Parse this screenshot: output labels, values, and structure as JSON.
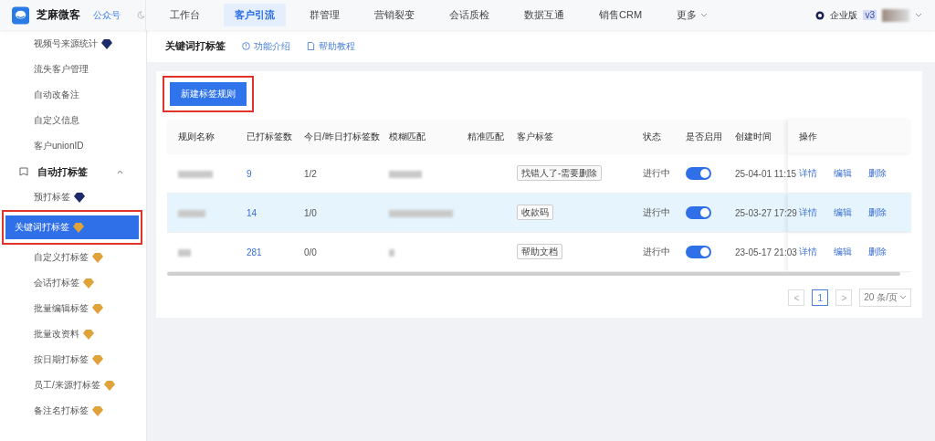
{
  "topbar": {
    "brand": "芝麻微客",
    "account_link": "公众号",
    "nav": [
      {
        "label": "工作台",
        "selected": false
      },
      {
        "label": "客户引流",
        "selected": true
      },
      {
        "label": "群管理",
        "selected": false
      },
      {
        "label": "营销裂变",
        "selected": false
      },
      {
        "label": "会话质检",
        "selected": false
      },
      {
        "label": "数据互通",
        "selected": false
      },
      {
        "label": "销售CRM",
        "selected": false
      },
      {
        "label": "更多",
        "selected": false,
        "kind": "dropdown"
      }
    ],
    "edition": "企业版",
    "version": "v3"
  },
  "sidebar": {
    "items": [
      {
        "label": "视频号来源统计",
        "kind": "item",
        "badge": true,
        "color": "#1d2b6b",
        "selected": false,
        "highlighted": false
      },
      {
        "label": "流失客户管理",
        "kind": "item",
        "badge": false,
        "selected": false,
        "highlighted": false
      },
      {
        "label": "自动改备注",
        "kind": "item",
        "badge": false,
        "selected": false,
        "highlighted": false
      },
      {
        "label": "自定义信息",
        "kind": "item",
        "badge": false,
        "selected": false,
        "highlighted": false
      },
      {
        "label": "客户unionID",
        "kind": "item",
        "badge": false,
        "selected": false,
        "highlighted": false
      },
      {
        "label": "自动打标签",
        "kind": "section",
        "expanded": true
      },
      {
        "label": "预打标签",
        "kind": "item",
        "badge": true,
        "color": "#1d2b6b",
        "selected": false,
        "highlighted": false
      },
      {
        "label": "关键词打标签",
        "kind": "item",
        "badge": true,
        "color": "#e0a33a",
        "selected": true,
        "highlighted": true
      },
      {
        "label": "自定义打标签",
        "kind": "item",
        "badge": true,
        "color": "#e0a33a",
        "selected": false,
        "highlighted": false
      },
      {
        "label": "会话打标签",
        "kind": "item",
        "badge": true,
        "color": "#e0a33a",
        "selected": false,
        "highlighted": false
      },
      {
        "label": "批量编辑标签",
        "kind": "item",
        "badge": true,
        "color": "#e0a33a",
        "selected": false,
        "highlighted": false
      },
      {
        "label": "批量改资料",
        "kind": "item",
        "badge": true,
        "color": "#e0a33a",
        "selected": false,
        "highlighted": false
      },
      {
        "label": "按日期打标签",
        "kind": "item",
        "badge": true,
        "color": "#e0a33a",
        "selected": false,
        "highlighted": false
      },
      {
        "label": "员工/来源打标签",
        "kind": "item",
        "badge": true,
        "color": "#e0a33a",
        "selected": false,
        "highlighted": false
      },
      {
        "label": "备注名打标签",
        "kind": "item",
        "badge": true,
        "color": "#e0a33a",
        "selected": false,
        "highlighted": false
      }
    ]
  },
  "page": {
    "title": "关键词打标签",
    "links": [
      "功能介绍",
      "帮助教程"
    ]
  },
  "new_button": {
    "label": "新建标签规则",
    "highlighted": true
  },
  "table": {
    "columns": [
      "规则名称",
      "已打标签数",
      "今日/昨日打标签数",
      "模糊匹配",
      "精准匹配",
      "客户标签",
      "状态",
      "是否启用",
      "创建时间",
      "操作"
    ],
    "rows": [
      {
        "tagged": "9",
        "today_yesterday": "1/2",
        "tag": "找错人了-需要删除",
        "status": "进行中",
        "enabled": true,
        "created": "25-04-01 11:15",
        "actions": [
          "详情",
          "编辑",
          "删除"
        ],
        "selected": false
      },
      {
        "tagged": "14",
        "today_yesterday": "1/0",
        "tag": "收款码",
        "status": "进行中",
        "enabled": true,
        "created": "25-03-27 17:29",
        "actions": [
          "详情",
          "编辑",
          "删除"
        ],
        "selected": true
      },
      {
        "tagged": "281",
        "today_yesterday": "0/0",
        "tag": "帮助文档",
        "status": "进行中",
        "enabled": true,
        "created": "23-05-17 21:03",
        "actions": [
          "详情",
          "编辑",
          "删除"
        ],
        "selected": false
      }
    ]
  },
  "pagination": {
    "prev": "<",
    "pages": [
      {
        "label": "1",
        "selected": true
      }
    ],
    "next": ">",
    "page_size": "20 条/页"
  }
}
